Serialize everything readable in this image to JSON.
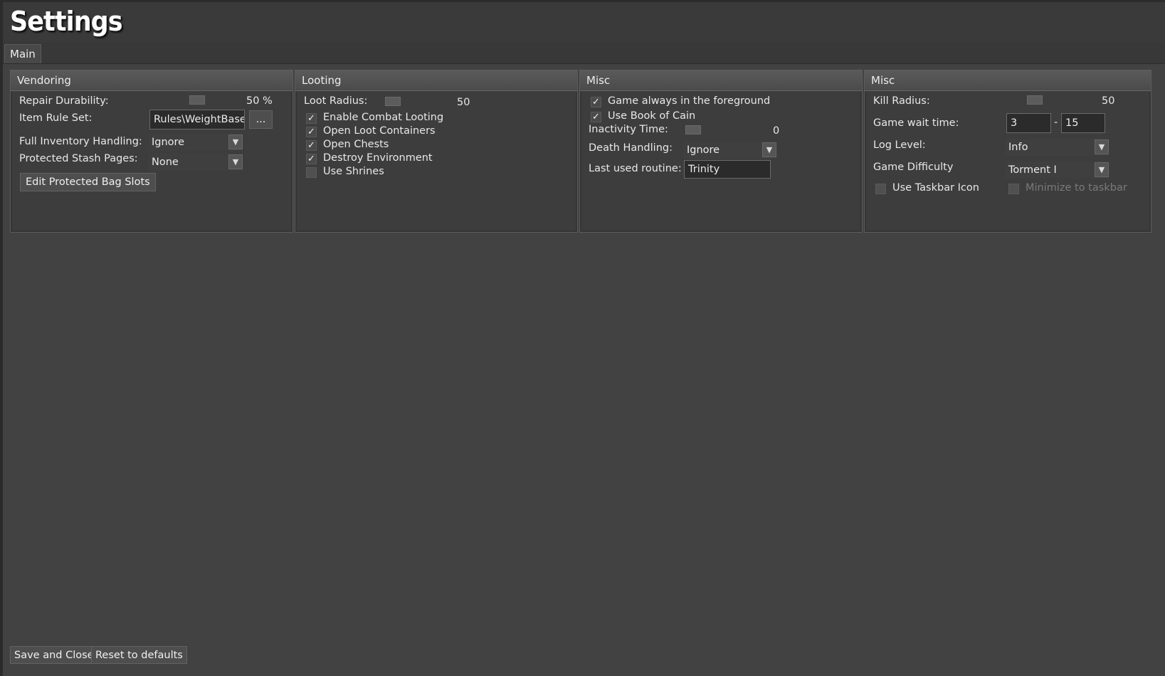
{
  "window": {
    "title": "Settings"
  },
  "tabs": [
    {
      "label": "Main"
    }
  ],
  "vendoring": {
    "header": "Vendoring",
    "repair_durability_label": "Repair Durability:",
    "repair_durability_value": "50 %",
    "item_rule_set_label": "Item Rule Set:",
    "item_rule_set_value": "Rules\\WeightBasedF",
    "browse_label": "...",
    "full_inventory_label": "Full Inventory Handling:",
    "full_inventory_value": "Ignore",
    "protected_stash_label": "Protected Stash Pages:",
    "protected_stash_value": "None",
    "edit_bag_slots_label": "Edit Protected Bag Slots"
  },
  "looting": {
    "header": "Looting",
    "loot_radius_label": "Loot Radius:",
    "loot_radius_value": "50",
    "options": [
      {
        "label": "Enable Combat Looting",
        "checked": true
      },
      {
        "label": "Open Loot Containers",
        "checked": true
      },
      {
        "label": "Open Chests",
        "checked": true
      },
      {
        "label": "Destroy Environment",
        "checked": true
      },
      {
        "label": "Use Shrines",
        "checked": false
      }
    ]
  },
  "misc1": {
    "header": "Misc",
    "foreground_label": "Game always in the foreground",
    "book_of_cain_label": "Use Book of Cain",
    "inactivity_label": "Inactivity Time:",
    "inactivity_value": "0",
    "death_handling_label": "Death Handling:",
    "death_handling_value": "Ignore",
    "last_routine_label": "Last used routine:",
    "last_routine_value": "Trinity"
  },
  "misc2": {
    "header": "Misc",
    "kill_radius_label": "Kill Radius:",
    "kill_radius_value": "50",
    "wait_time_label": "Game wait time:",
    "wait_min": "3",
    "wait_sep": "-",
    "wait_max": "15",
    "log_level_label": "Log Level:",
    "log_level_value": "Info",
    "difficulty_label": "Game Difficulty",
    "difficulty_value": "Torment I",
    "taskbar_icon_label": "Use Taskbar Icon",
    "minimize_label": "Minimize to taskbar"
  },
  "footer": {
    "save_label": "Save and Close",
    "reset_label": "Reset to defaults"
  },
  "colors": {
    "background": "#424242",
    "panel": "#3d3d3d",
    "header": "#4f4f4f",
    "text": "#e8e8e8",
    "disabled_text": "#7a7a7a"
  },
  "icons": {
    "check": "checkmark-icon",
    "dropdown": "chevron-down-icon"
  }
}
